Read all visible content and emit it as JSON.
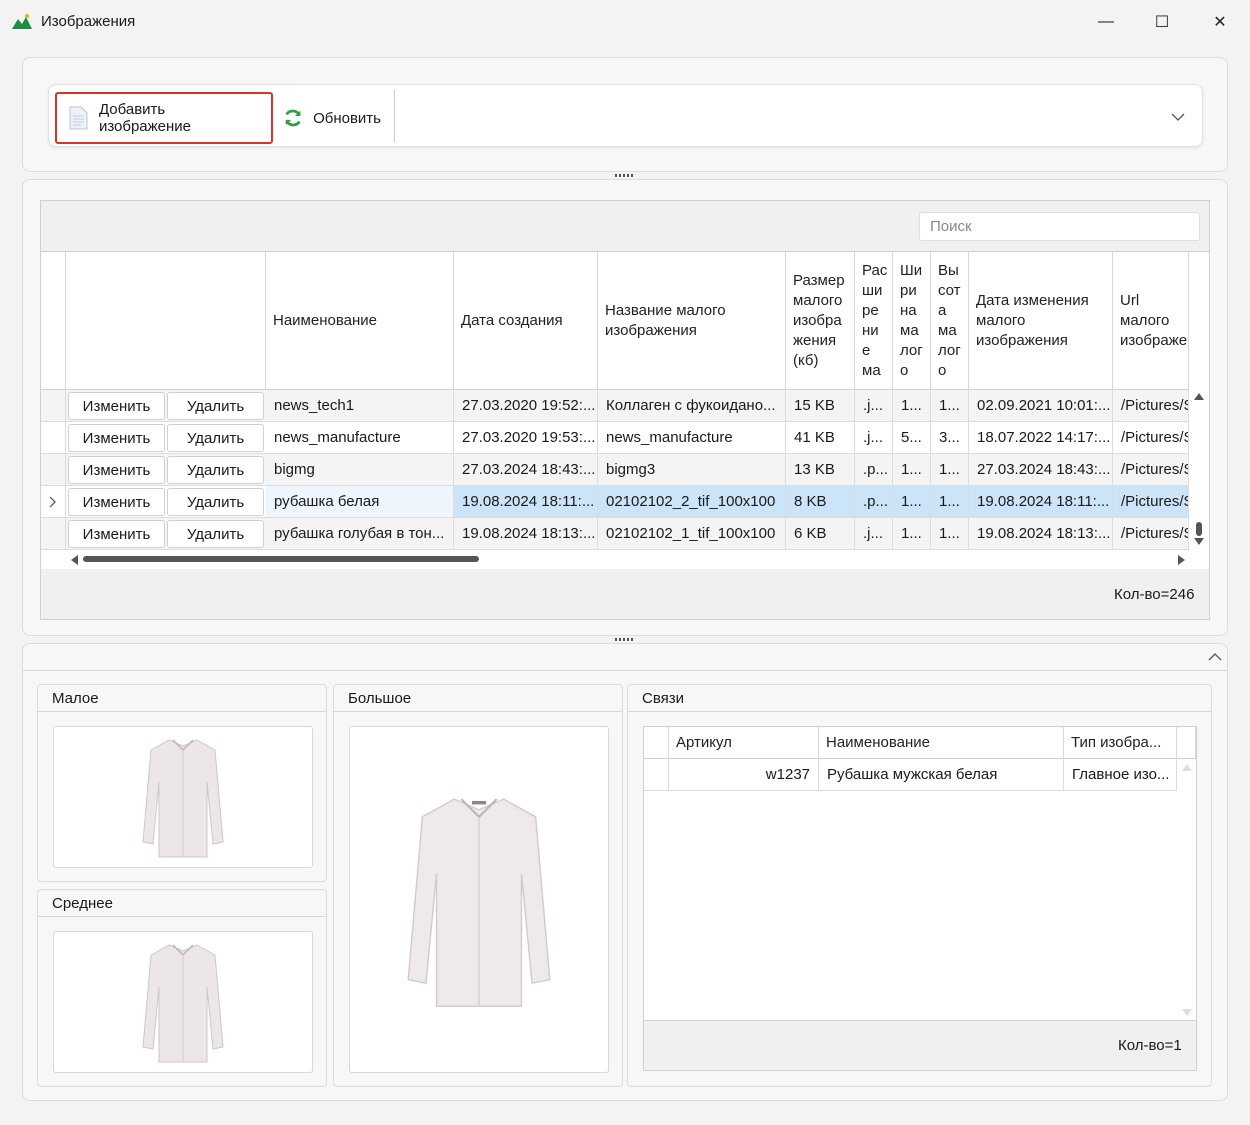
{
  "window": {
    "title": "Изображения",
    "minimize": "—",
    "maximize": "☐",
    "close": "✕"
  },
  "toolbar": {
    "add_label": "Добавить изображение",
    "refresh_label": "Обновить",
    "overflow_icon": "chevron-down-icon"
  },
  "grid": {
    "search_placeholder": "Поиск",
    "columns": [
      "Наименование",
      "Дата создания",
      "Название малого изображения",
      "Размер малого изобра жения (кб)",
      "Рас ши ре ни е ма",
      "Ши ри на ма лог о",
      "Вы сот а ма лог о",
      "Дата изменения малого изображения",
      "Url малого изображе"
    ],
    "edit_label": "Изменить",
    "delete_label": "Удалить",
    "rows": [
      {
        "name": "news_tech1",
        "created": "27.03.2020 19:52:...",
        "small_name": "Коллаген с фукоидано...",
        "size": "15 KB",
        "ext": ".j...",
        "width": "1...",
        "height": "1...",
        "modified": "02.09.2021 10:01:...",
        "url": "/Pictures/S"
      },
      {
        "name": "news_manufacture",
        "created": "27.03.2020 19:53:...",
        "small_name": "news_manufacture",
        "size": "41 KB",
        "ext": ".j...",
        "width": "5...",
        "height": "3...",
        "modified": "18.07.2022 14:17:...",
        "url": "/Pictures/S"
      },
      {
        "name": "bigmg",
        "created": "27.03.2024 18:43:...",
        "small_name": "bigmg3",
        "size": "13 KB",
        "ext": ".p...",
        "width": "1...",
        "height": "1...",
        "modified": "27.03.2024 18:43:...",
        "url": "/Pictures/S"
      },
      {
        "name": "рубашка белая",
        "created": "19.08.2024 18:11:...",
        "small_name": "02102102_2_tif_100x100",
        "size": "8 KB",
        "ext": ".p...",
        "width": "1...",
        "height": "1...",
        "modified": "19.08.2024 18:11:...",
        "url": "/Pictures/S"
      },
      {
        "name": "рубашка голубая в тон...",
        "created": "19.08.2024 18:13:...",
        "small_name": "02102102_1_tif_100x100",
        "size": "6 KB",
        "ext": ".j...",
        "width": "1...",
        "height": "1...",
        "modified": "19.08.2024 18:13:...",
        "url": "/Pictures/S"
      }
    ],
    "selected_row": 3,
    "count": "Кол-во=246"
  },
  "preview": {
    "small_title": "Малое",
    "medium_title": "Среднее",
    "large_title": "Большое"
  },
  "links": {
    "title": "Связи",
    "columns": [
      "Артикул",
      "Наименование",
      "Тип изобра..."
    ],
    "rows": [
      {
        "article": "w1237",
        "name": "Рубашка мужская белая",
        "type": "Главное изо..."
      }
    ],
    "count": "Кол-во=1"
  }
}
